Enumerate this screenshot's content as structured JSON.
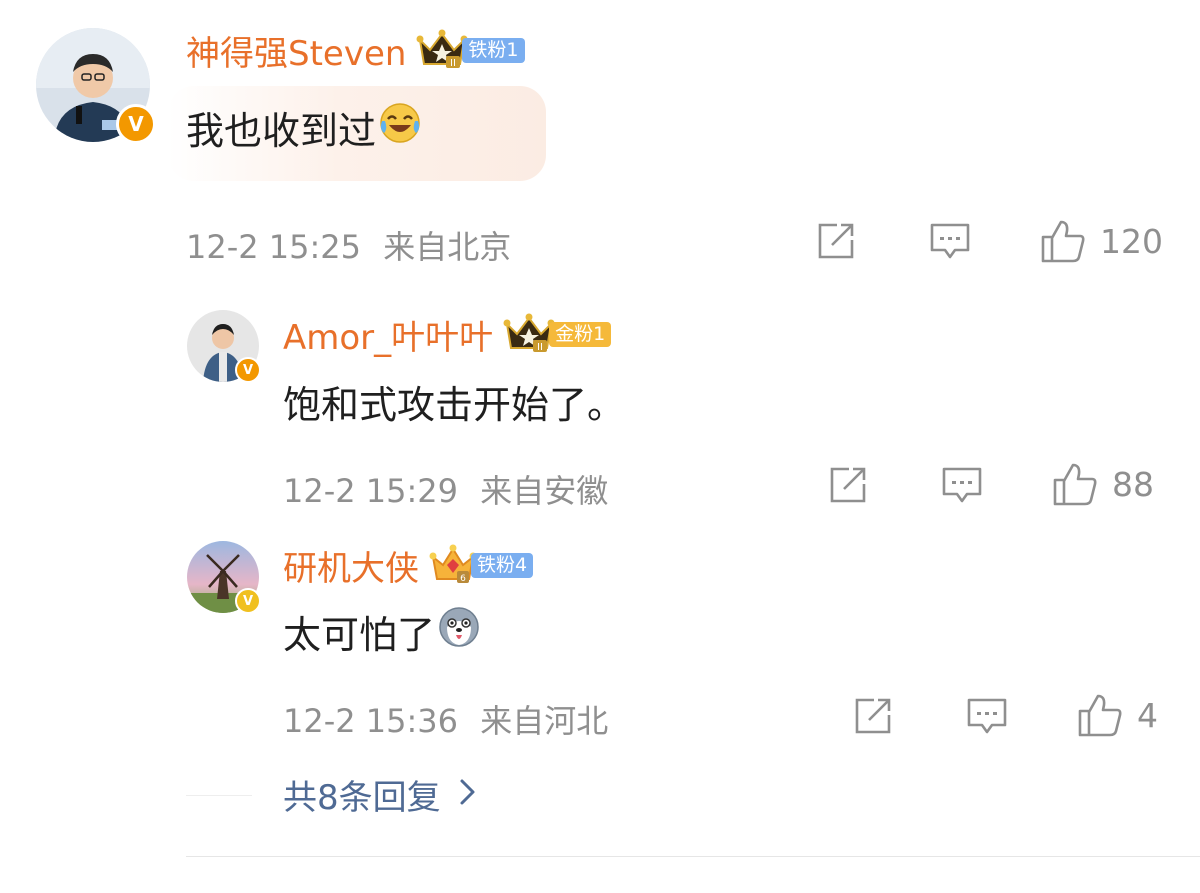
{
  "comments": [
    {
      "username": "神得强Steven",
      "fan_badge": "铁粉1",
      "fan_badge_color": "#7aaef0",
      "text": "我也收到过",
      "emoji": "laugh-cry-emoji",
      "timestamp": "12-2 15:25",
      "location": "来自北京",
      "likes": "120"
    },
    {
      "username": "Amor_叶叶叶",
      "fan_badge": "金粉1",
      "fan_badge_color": "#f5b93a",
      "text": "饱和式攻击开始了。",
      "timestamp": "12-2 15:29",
      "location": "来自安徽",
      "likes": "88"
    },
    {
      "username": "研机大侠",
      "fan_badge": "铁粉4",
      "fan_badge_color": "#7aaef0",
      "text": "太可怕了",
      "emoji": "husky-dog-emoji",
      "timestamp": "12-2 15:36",
      "location": "来自河北",
      "likes": "4"
    }
  ],
  "more_replies": "共8条回复",
  "colors": {
    "username": "#e8702a",
    "link": "#4f6a94",
    "meta": "#8f8f8f",
    "verified": "#f39800"
  },
  "icons": [
    "share-icon",
    "reply-icon",
    "like-icon",
    "verified-icon",
    "crown-icon",
    "chevron-right-icon"
  ]
}
